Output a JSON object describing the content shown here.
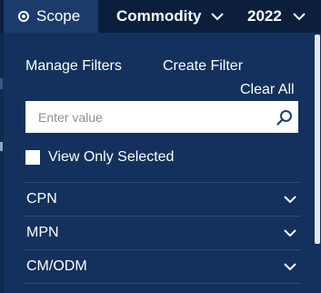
{
  "topbar": {
    "scope_label": "Scope",
    "commodity_label": "Commodity",
    "year_label": "2022"
  },
  "panel": {
    "manage_filters": "Manage Filters",
    "create_filter": "Create Filter",
    "clear_all": "Clear All",
    "search": {
      "placeholder": "Enter value",
      "value": ""
    },
    "view_only_selected": {
      "label": "View Only Selected",
      "checked": false
    },
    "sections": [
      {
        "label": "CPN"
      },
      {
        "label": "MPN"
      },
      {
        "label": "CM/ODM"
      }
    ]
  },
  "colors": {
    "panel_bg": "#13315c",
    "topbar_bg": "#0b1f3d",
    "active_tab_bg": "#1b3b6b",
    "divider": "#2e4d78",
    "search_icon": "#1d3f73"
  },
  "icons": {
    "scope": "radio-target-icon",
    "dropdown": "chevron-down-icon",
    "search": "search-icon",
    "section_toggle": "chevron-down-icon"
  }
}
